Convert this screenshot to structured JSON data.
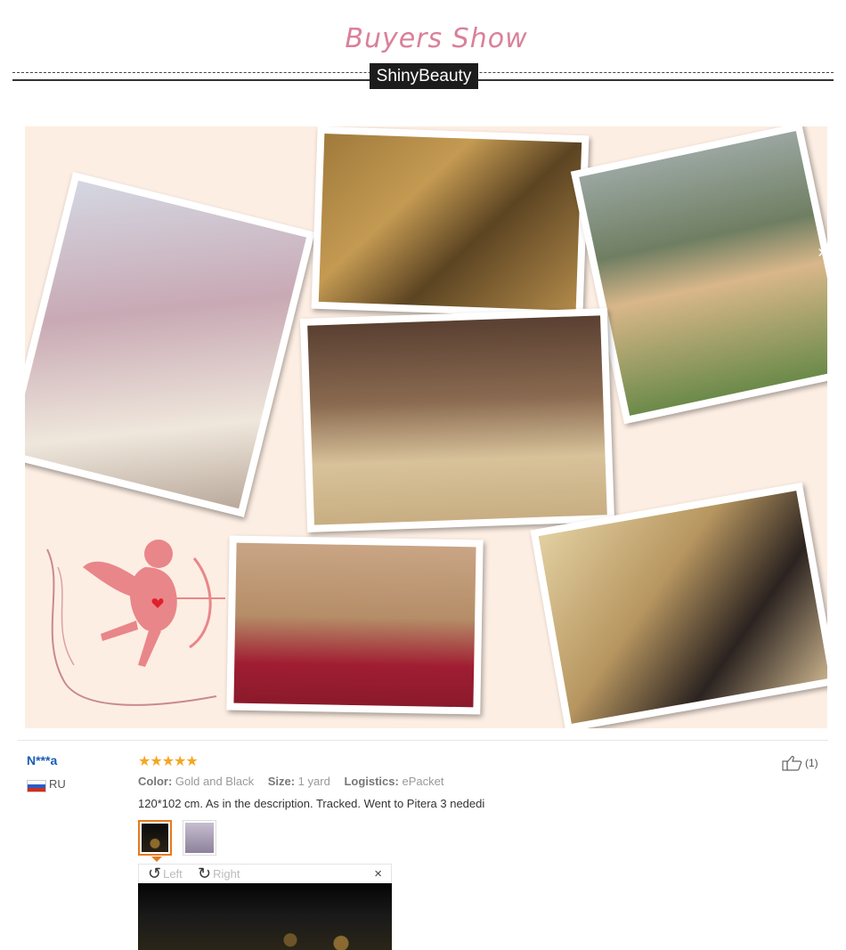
{
  "banner": {
    "title": "Buyers  Show",
    "brand": "ShinyBeauty"
  },
  "colors": {
    "accent": "#d9809b",
    "link": "#1a5db3",
    "star": "#f5a623",
    "selected_thumb": "#e87a1d"
  },
  "review": {
    "user": "N***a",
    "country": "RU",
    "rating": "★★★★★",
    "color_label": "Color:",
    "color_value": "Gold and Black",
    "size_label": "Size:",
    "size_value": "1 yard",
    "logistics_label": "Logistics:",
    "logistics_value": "ePacket",
    "text": "120*102 cm. As in the description. Tracked. Went to Pitera 3 nededi",
    "likes": "(1)"
  },
  "viewer": {
    "rotate_left": "Left",
    "rotate_right": "Right",
    "close": "×"
  }
}
